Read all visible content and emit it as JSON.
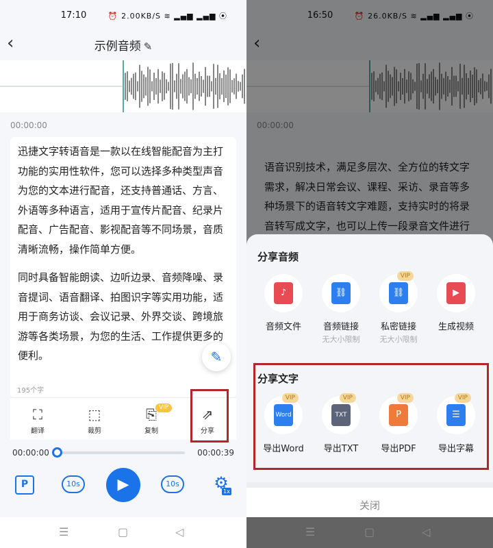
{
  "left": {
    "status_time": "17:10",
    "status_icons": "⏰ 2.00KB/S ≋ ▂▄▆ ▂▄▆ ⦿",
    "title": "示例音频",
    "timestamp": "00:00:00",
    "para1": "迅捷文字转语音是一款以在线智能配音为主打功能的实用性软件，您可以选择多种类型声音为您的文本进行配音，还支持普通话、方言、外语等多种语言，适用于宣传片配音、纪录片配音、广告配音、影视配音等不同场景，音质清晰流畅，操作简单方便。",
    "para2": "同时具备智能朗读、边听边录、音频降噪、录音提词、语音翻译、拍图识字等实用功能，适用于商务访谈、会议记录、外界交谈、跨境旅游等各类场景，为您的生活、工作提供更多的便利。",
    "char_count": "195个字",
    "tools": [
      {
        "label": "翻译"
      },
      {
        "label": "裁剪"
      },
      {
        "label": "复制",
        "badge": "VIP"
      },
      {
        "label": "分享"
      }
    ],
    "time_start": "00:00:00",
    "time_end": "00:00:39",
    "progress": 0,
    "skip_back": "10s",
    "skip_fwd": "10s",
    "speed": "1x"
  },
  "right": {
    "status_time": "16:50",
    "status_icons": "⏰ 26.0KB/S ≋ ▂▄▆ ▂▄▆ ⦿",
    "timestamp": "00:00:00",
    "para": "语音识别技术，满足多层次、全方位的转文字需求，解决日常会议、课程、采访、录音等多种场景下的语音转文字难题，支持实时的将录音转写成文字，也可以上传一段录音文件进行",
    "share_audio_title": "分享音频",
    "audio_options": [
      {
        "label": "音频文件",
        "sub": "",
        "color": "#e94b55",
        "icon": "♪"
      },
      {
        "label": "音频链接",
        "sub": "无大小限制",
        "color": "#2d7ff0",
        "icon": "⛓"
      },
      {
        "label": "私密链接",
        "sub": "无大小限制",
        "color": "#2d7ff0",
        "icon": "⛓",
        "badge": "VIP"
      },
      {
        "label": "生成视频",
        "sub": "",
        "color": "#e94b55",
        "icon": "▶"
      }
    ],
    "share_text_title": "分享文字",
    "text_options": [
      {
        "label": "导出Word",
        "color": "#2d7ff0",
        "icon": "Word",
        "badge": "VIP"
      },
      {
        "label": "导出TXT",
        "color": "#5b6478",
        "icon": "TXT",
        "badge": "VIP"
      },
      {
        "label": "导出PDF",
        "color": "#f07a3a",
        "icon": "P",
        "badge": "VIP"
      },
      {
        "label": "导出字幕",
        "color": "#2d7ff0",
        "icon": "☰",
        "badge": "VIP"
      }
    ],
    "close_label": "关闭"
  },
  "colors": {
    "accent": "#1a73e8",
    "highlight": "#b3262b",
    "vip": "#f6c443"
  }
}
